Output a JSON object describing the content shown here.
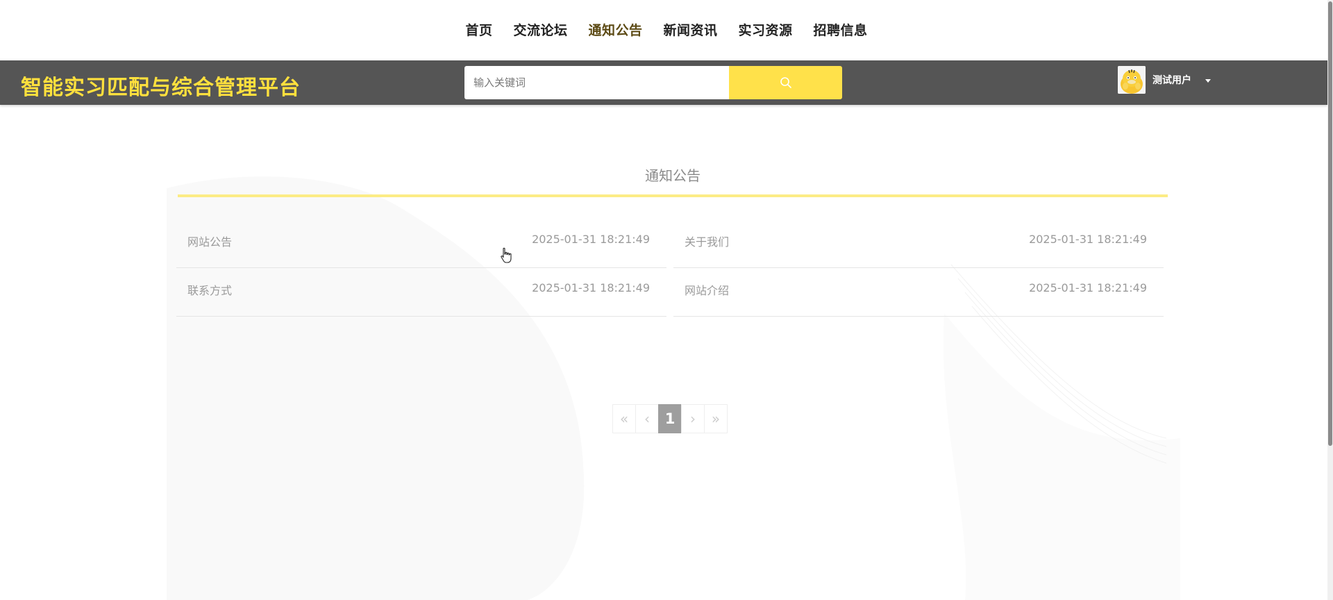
{
  "nav": {
    "items": [
      {
        "label": "首页"
      },
      {
        "label": "交流论坛"
      },
      {
        "label": "通知公告",
        "active": true
      },
      {
        "label": "新闻资讯"
      },
      {
        "label": "实习资源"
      },
      {
        "label": "招聘信息"
      }
    ]
  },
  "header": {
    "site_title": "智能实习匹配与综合管理平台",
    "search_placeholder": "输入关键词",
    "search_icon": "search-icon",
    "username": "测试用户",
    "accent_color": "#ffe14a",
    "bar_color": "#555555"
  },
  "main": {
    "section_title": "通知公告",
    "notices": [
      {
        "title": "网站公告",
        "time": "2025-01-31 18:21:49"
      },
      {
        "title": "关于我们",
        "time": "2025-01-31 18:21:49"
      },
      {
        "title": "联系方式",
        "time": "2025-01-31 18:21:49"
      },
      {
        "title": "网站介绍",
        "time": "2025-01-31 18:21:49"
      }
    ]
  },
  "pagination": {
    "first": "«",
    "prev": "‹",
    "current": "1",
    "next": "›",
    "last": "»"
  }
}
